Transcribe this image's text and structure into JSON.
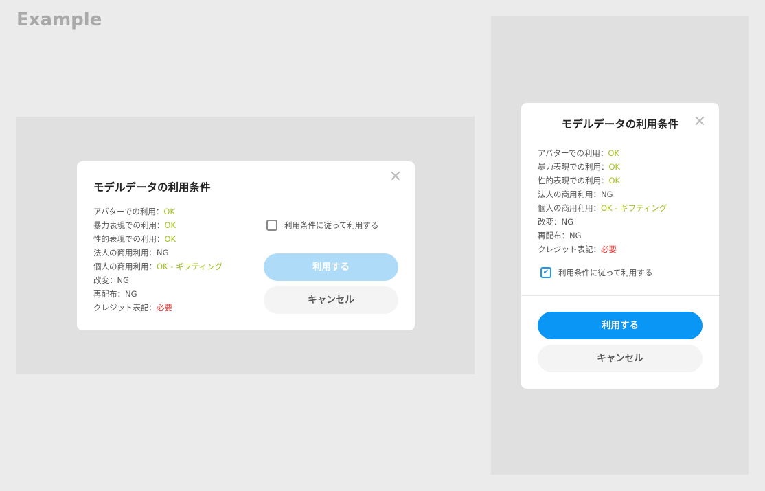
{
  "page": {
    "heading": "Example"
  },
  "dialog": {
    "title": "モデルデータの利用条件",
    "close_glyph": "✕",
    "terms": [
      {
        "label": "アバターでの利用：",
        "value": "OK",
        "status": "ok"
      },
      {
        "label": "暴力表現での利用：",
        "value": "OK",
        "status": "ok"
      },
      {
        "label": "性的表現での利用：",
        "value": "OK",
        "status": "ok"
      },
      {
        "label": "法人の商用利用：",
        "value": "NG",
        "status": "ng"
      },
      {
        "label": "個人の商用利用：",
        "value": "OK - ギフティング",
        "status": "ok"
      },
      {
        "label": "改変：",
        "value": "NG",
        "status": "ng"
      },
      {
        "label": "再配布：",
        "value": "NG",
        "status": "ng"
      },
      {
        "label": "クレジット表記：",
        "value": "必要",
        "status": "required"
      }
    ],
    "agree_label": "利用条件に従って利用する",
    "use_button": "利用する",
    "cancel_button": "キャンセル"
  },
  "variants": {
    "wide": {
      "agree_checked": false,
      "use_button_enabled": false
    },
    "narrow": {
      "agree_checked": true,
      "use_button_enabled": true,
      "check_glyph": "✔"
    }
  },
  "colors": {
    "ok": "#a2c21e",
    "required": "#e53935",
    "primary": "#0a96f5",
    "primary_disabled": "#aedcf8",
    "cancel_bg": "#f4f4f4"
  }
}
